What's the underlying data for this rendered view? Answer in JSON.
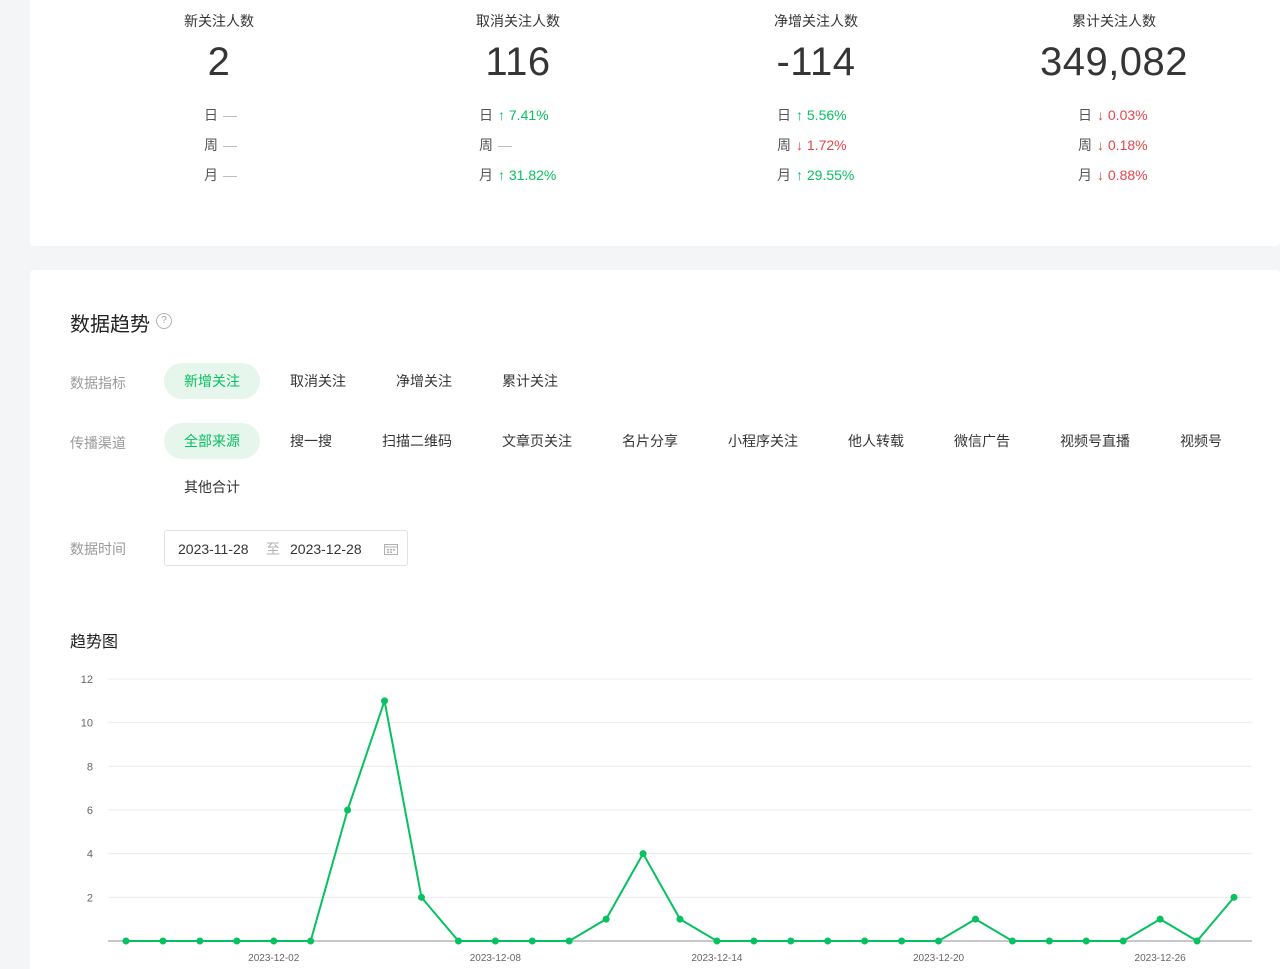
{
  "stats": [
    {
      "title": "新关注人数",
      "value": "2",
      "rows": [
        {
          "label": "日",
          "delta": "—",
          "dir": "none"
        },
        {
          "label": "周",
          "delta": "—",
          "dir": "none"
        },
        {
          "label": "月",
          "delta": "—",
          "dir": "none"
        }
      ]
    },
    {
      "title": "取消关注人数",
      "value": "116",
      "rows": [
        {
          "label": "日",
          "delta": "↑ 7.41%",
          "dir": "up"
        },
        {
          "label": "周",
          "delta": "—",
          "dir": "none"
        },
        {
          "label": "月",
          "delta": "↑ 31.82%",
          "dir": "up"
        }
      ]
    },
    {
      "title": "净增关注人数",
      "value": "-114",
      "rows": [
        {
          "label": "日",
          "delta": "↑ 5.56%",
          "dir": "up"
        },
        {
          "label": "周",
          "delta": "↓ 1.72%",
          "dir": "down"
        },
        {
          "label": "月",
          "delta": "↑ 29.55%",
          "dir": "up"
        }
      ]
    },
    {
      "title": "累计关注人数",
      "value": "349,082",
      "rows": [
        {
          "label": "日",
          "delta": "↓ 0.03%",
          "dir": "down"
        },
        {
          "label": "周",
          "delta": "↓ 0.18%",
          "dir": "down"
        },
        {
          "label": "月",
          "delta": "↓ 0.88%",
          "dir": "down"
        }
      ]
    }
  ],
  "trend": {
    "title": "数据趋势",
    "help_icon": "question-circle-icon",
    "metric_label": "数据指标",
    "metrics": [
      "新增关注",
      "取消关注",
      "净增关注",
      "累计关注"
    ],
    "metric_selected": "新增关注",
    "channel_label": "传播渠道",
    "channels": [
      "全部来源",
      "搜一搜",
      "扫描二维码",
      "文章页关注",
      "名片分享",
      "小程序关注",
      "他人转载",
      "微信广告",
      "视频号直播",
      "视频号",
      "其他合计"
    ],
    "channel_selected": "全部来源",
    "time_label": "数据时间",
    "date_start": "2023-11-28",
    "date_sep": "至",
    "date_end": "2023-12-28",
    "calendar_icon": "calendar-icon",
    "chart_title": "趋势图"
  },
  "colors": {
    "accent": "#07c160",
    "down": "#e4464b"
  },
  "chart_data": {
    "type": "line",
    "title": "趋势图",
    "x": [
      "2023-11-28",
      "2023-11-29",
      "2023-11-30",
      "2023-12-01",
      "2023-12-02",
      "2023-12-03",
      "2023-12-04",
      "2023-12-05",
      "2023-12-06",
      "2023-12-07",
      "2023-12-08",
      "2023-12-09",
      "2023-12-10",
      "2023-12-11",
      "2023-12-12",
      "2023-12-13",
      "2023-12-14",
      "2023-12-15",
      "2023-12-16",
      "2023-12-17",
      "2023-12-18",
      "2023-12-19",
      "2023-12-20",
      "2023-12-21",
      "2023-12-22",
      "2023-12-23",
      "2023-12-24",
      "2023-12-25",
      "2023-12-26",
      "2023-12-27",
      "2023-12-28"
    ],
    "series": [
      {
        "values": [
          0,
          0,
          0,
          0,
          0,
          0,
          6,
          11,
          2,
          0,
          0,
          0,
          0,
          1,
          4,
          1,
          0,
          0,
          0,
          0,
          0,
          0,
          0,
          1,
          0,
          0,
          0,
          0,
          1,
          0,
          2
        ]
      }
    ],
    "x_tick_labels": [
      "2023-12-02",
      "2023-12-08",
      "2023-12-14",
      "2023-12-20",
      "2023-12-26"
    ],
    "y_ticks": [
      2,
      4,
      6,
      8,
      10,
      12
    ],
    "ylim": [
      0,
      12
    ],
    "grid": true,
    "line_color": "#07c160"
  }
}
